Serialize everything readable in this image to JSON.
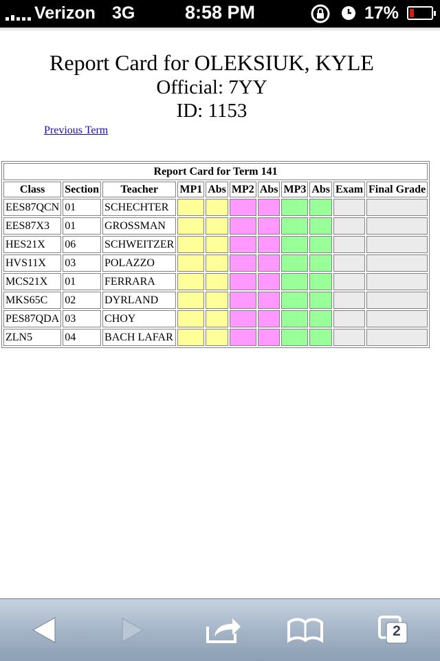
{
  "status_bar": {
    "carrier": "Verizon",
    "network": "3G",
    "time": "8:58 PM",
    "battery_percent": "17%",
    "battery_color": "#d81b1b"
  },
  "header": {
    "title": "Report Card for OLEKSIUK, KYLE",
    "official": "Official: 7YY",
    "id": "ID: 1153",
    "previous_term_link": "Previous Term"
  },
  "table": {
    "caption": "Report Card for Term 141",
    "columns": [
      "Class",
      "Section",
      "Teacher",
      "MP1",
      "Abs",
      "MP2",
      "Abs",
      "MP3",
      "Abs",
      "Exam",
      "Final Grade"
    ],
    "rows": [
      {
        "class": "EES87QCN",
        "section": "01",
        "teacher": "SCHECHTER"
      },
      {
        "class": "EES87X3",
        "section": "01",
        "teacher": "GROSSMAN"
      },
      {
        "class": "HES21X",
        "section": "06",
        "teacher": "SCHWEITZER"
      },
      {
        "class": "HVS11X",
        "section": "03",
        "teacher": "POLAZZO"
      },
      {
        "class": "MCS21X",
        "section": "01",
        "teacher": "FERRARA"
      },
      {
        "class": "MKS65C",
        "section": "02",
        "teacher": "DYRLAND"
      },
      {
        "class": "PES87QDA",
        "section": "03",
        "teacher": "CHOY"
      },
      {
        "class": "ZLN5",
        "section": "04",
        "teacher": "BACH LAFAR"
      }
    ],
    "colors": {
      "mp1": "#ffff99",
      "mp2": "#ff99ff",
      "mp3": "#99ff99",
      "exam": "#ebebeb"
    }
  },
  "toolbar": {
    "tabs_count": "2",
    "icons": [
      "back-icon",
      "forward-icon",
      "share-icon",
      "bookmarks-icon",
      "tabs-icon"
    ]
  }
}
